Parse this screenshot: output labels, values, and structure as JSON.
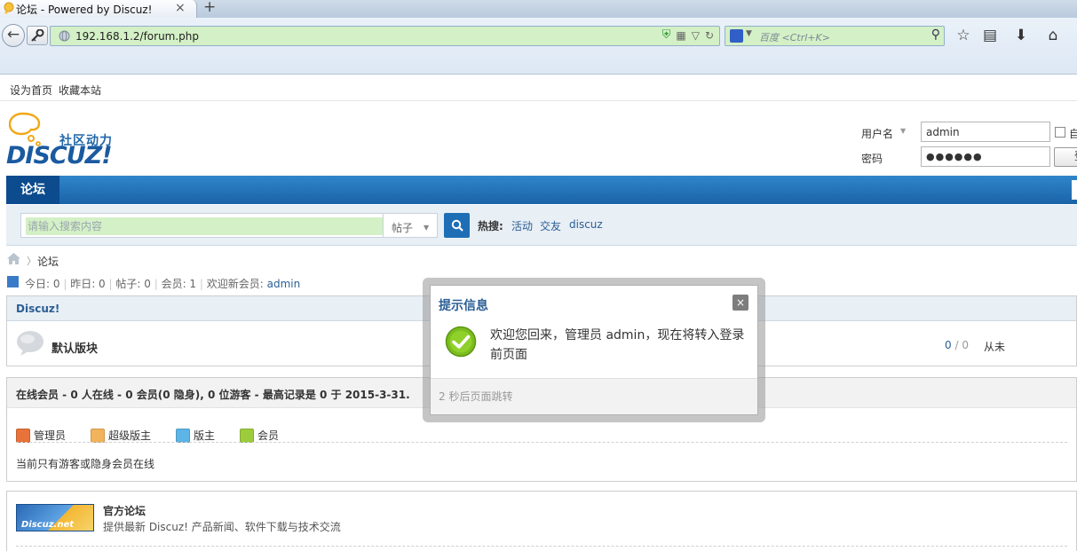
{
  "browser": {
    "tab_title": "论坛 - Powered by Discuz!",
    "tab_close": "×",
    "new_tab": "+",
    "url": "192.168.1.2/forum.php",
    "search_placeholder": "百度 <Ctrl+K>"
  },
  "topbar": {
    "set_home": "设为首页",
    "bookmark": "收藏本站"
  },
  "logo": {
    "tagline": "社区动力",
    "brand": "DISCUZ!"
  },
  "login": {
    "username_label": "用户名",
    "username_value": "admin",
    "password_label": "密码",
    "password_value": "●●●●●●",
    "remember_label": "自",
    "login_button": "登"
  },
  "nav": {
    "active": "论坛"
  },
  "search": {
    "placeholder": "请输入搜索内容",
    "type": "帖子",
    "hot_label": "热搜:",
    "hot_links": [
      "活动",
      "交友",
      "discuz"
    ]
  },
  "breadcrumb": {
    "current": "论坛"
  },
  "stats": {
    "today": "今日: 0",
    "yesterday": "昨日: 0",
    "posts": "帖子: 0",
    "members": "会员: 1",
    "welcome_prefix": "欢迎新会员: ",
    "newest_member": "admin"
  },
  "category": {
    "title": "Discuz!",
    "forum_name": "默认版块",
    "threads": "0",
    "posts_sep": " / ",
    "posts": "0",
    "last_post": "从未"
  },
  "online": {
    "title": "在线会员 - 0 人在线 - 0 会员(0 隐身), 0 位游客 - 最高记录是 0 于 2015-3-31.",
    "legend": [
      {
        "label": "管理员",
        "color": "#e8733a"
      },
      {
        "label": "超级版主",
        "color": "#f2b35a"
      },
      {
        "label": "版主",
        "color": "#5db4e6"
      },
      {
        "label": "会员",
        "color": "#9ccc3c"
      }
    ],
    "note": "当前只有游客或隐身会员在线"
  },
  "partner": {
    "logo_text": "Discuz.net",
    "name": "官方论坛",
    "desc": "提供最新 Discuz! 产品新闻、软件下载与技术交流"
  },
  "modal": {
    "title": "提示信息",
    "close": "×",
    "message": "欢迎您回来，管理员 admin，现在将转入登录前页面",
    "footer": "2 秒后页面跳转"
  }
}
